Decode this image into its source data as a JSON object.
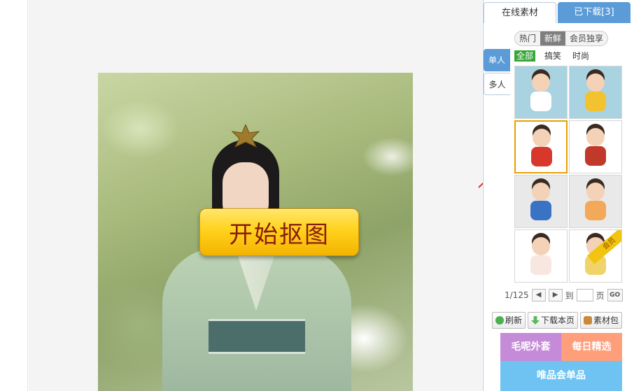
{
  "canvas": {
    "start_button_label": "开始抠图"
  },
  "panel": {
    "tabs": [
      {
        "label": "在线素材"
      },
      {
        "label": "已下载[3]"
      }
    ],
    "sort_options": [
      {
        "label": "热门"
      },
      {
        "label": "新鲜"
      },
      {
        "label": "会员独享"
      }
    ],
    "side_tabs": [
      {
        "label": "单人"
      },
      {
        "label": "多人"
      }
    ],
    "filters": [
      {
        "label": "全部"
      },
      {
        "label": "搞笑"
      },
      {
        "label": "时尚"
      }
    ],
    "vip_badge": "会员",
    "pager": {
      "current": "1/125",
      "to_label": "到",
      "page_label": "页",
      "go_label": "GO"
    },
    "actions": {
      "refresh": "刷新",
      "download_page": "下载本页",
      "material_pack": "素材包"
    },
    "banners": {
      "left": "毛呢外套",
      "right": "每日精选",
      "bottom": "唯品会单品"
    }
  },
  "colors": {
    "accent_blue": "#5a9bd8",
    "start_button": "#ffd21d",
    "filter_active": "#3aa63a",
    "selected_border": "#e8a000"
  }
}
